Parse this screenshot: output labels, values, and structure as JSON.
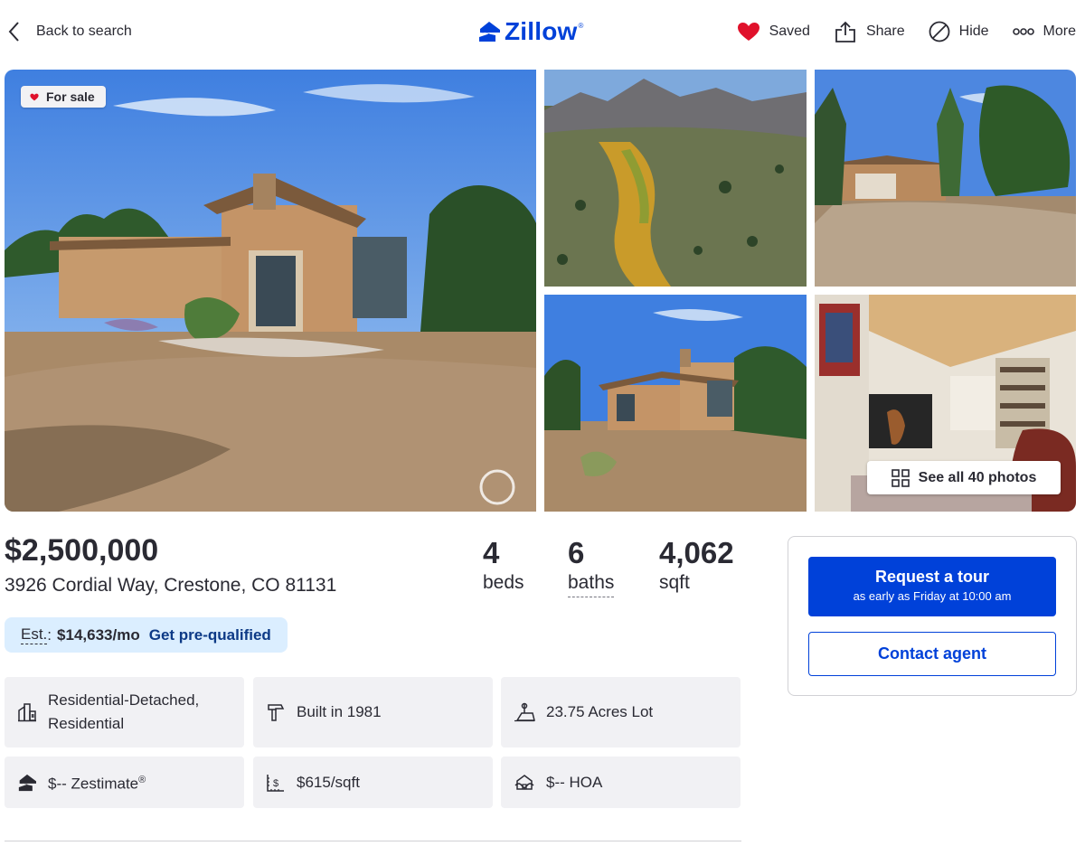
{
  "header": {
    "back_label": "Back to search",
    "logo_text": "Zillow",
    "logo_mark": "®",
    "actions": [
      {
        "label": "Saved",
        "icon": "heart-filled-icon",
        "color": "#e0112b"
      },
      {
        "label": "Share",
        "icon": "share-icon"
      },
      {
        "label": "Hide",
        "icon": "hide-icon"
      },
      {
        "label": "More",
        "icon": "more-icon"
      }
    ]
  },
  "photos": {
    "badge_label": "For sale",
    "see_all_label": "See all 40 photos",
    "items": [
      {
        "name": "photo-main-exterior",
        "subject": "adobe house exterior with dirt yard"
      },
      {
        "name": "photo-aerial-mountains",
        "subject": "aerial view of valley and mountains"
      },
      {
        "name": "photo-garage-driveway",
        "subject": "garage and gravel driveway"
      },
      {
        "name": "photo-exterior-side",
        "subject": "house exterior side view"
      },
      {
        "name": "photo-interior-living",
        "subject": "interior living room with wood ceiling"
      }
    ]
  },
  "listing": {
    "price": "$2,500,000",
    "address": "3926 Cordial Way, Crestone, CO 81131",
    "beds_value": "4",
    "beds_label": "beds",
    "baths_value": "6",
    "baths_label": "baths",
    "sqft_value": "4,062",
    "sqft_label": "sqft"
  },
  "estimate": {
    "label": "Est.",
    "colon": ":",
    "value": "$14,633/mo",
    "link_label": "Get pre-qualified"
  },
  "details": {
    "type": "Residential-Detached, Residential",
    "built": "Built in 1981",
    "lot": "23.75 Acres Lot",
    "zestimate": "$-- Zestimate",
    "zestimate_mark": "®",
    "price_per_sqft": "$615/sqft",
    "hoa": "$-- HOA"
  },
  "agent_card": {
    "tour_title": "Request a tour",
    "tour_sub": "as early as Friday at 10:00 am",
    "contact_label": "Contact agent"
  },
  "colors": {
    "brand": "#0041d9",
    "heart": "#e0112b",
    "estimate_bg": "#dbeeff",
    "tile_bg": "#f1f1f4"
  }
}
